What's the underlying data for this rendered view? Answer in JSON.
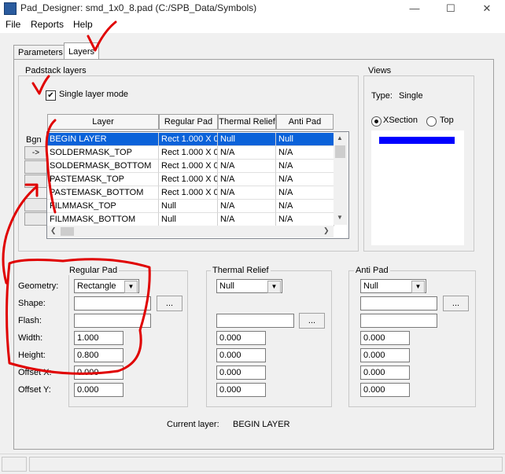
{
  "window": {
    "title": "Pad_Designer: smd_1x0_8.pad (C:/SPB_Data/Symbols)",
    "controls": [
      "—",
      "☐",
      "✕"
    ]
  },
  "menu": [
    "File",
    "Reports",
    "Help"
  ],
  "tabs": [
    {
      "label": "Parameters",
      "active": false
    },
    {
      "label": "Layers",
      "active": true
    }
  ],
  "padstack": {
    "group_label": "Padstack layers",
    "single_layer_mode_label": "Single layer mode",
    "single_layer_mode_checked": true,
    "side_button_label": "Bgn",
    "side_arrow": "->",
    "columns": [
      "Layer",
      "Regular Pad",
      "Thermal Relief",
      "Anti Pad"
    ],
    "rows": [
      {
        "layer": "BEGIN LAYER",
        "regular": "Rect 1.000 X 0",
        "thermal": "Null",
        "anti": "Null",
        "selected": true
      },
      {
        "layer": "SOLDERMASK_TOP",
        "regular": "Rect 1.000 X 0",
        "thermal": "N/A",
        "anti": "N/A",
        "selected": false
      },
      {
        "layer": "SOLDERMASK_BOTTOM",
        "regular": "Rect 1.000 X 0",
        "thermal": "N/A",
        "anti": "N/A",
        "selected": false
      },
      {
        "layer": "PASTEMASK_TOP",
        "regular": "Rect 1.000 X 0",
        "thermal": "N/A",
        "anti": "N/A",
        "selected": false
      },
      {
        "layer": "PASTEMASK_BOTTOM",
        "regular": "Rect 1.000 X 0",
        "thermal": "N/A",
        "anti": "N/A",
        "selected": false
      },
      {
        "layer": "FILMMASK_TOP",
        "regular": "Null",
        "thermal": "N/A",
        "anti": "N/A",
        "selected": false
      },
      {
        "layer": "FILMMASK_BOTTOM",
        "regular": "Null",
        "thermal": "N/A",
        "anti": "N/A",
        "selected": false
      }
    ]
  },
  "views": {
    "group_label": "Views",
    "type_label": "Type:",
    "type_value": "Single",
    "xsection_label": "XSection",
    "top_label": "Top",
    "selected": "XSection",
    "preview_color": "#0000ff"
  },
  "regular_pad": {
    "group_label": "Regular Pad",
    "labels": {
      "geometry": "Geometry:",
      "shape": "Shape:",
      "flash": "Flash:",
      "width": "Width:",
      "height": "Height:",
      "offset_x": "Offset X:",
      "offset_y": "Offset Y:"
    },
    "geometry": "Rectangle",
    "shape": "",
    "flash": "",
    "width": "1.000",
    "height": "0.800",
    "offset_x": "0.000",
    "offset_y": "0.000",
    "browse_label": "..."
  },
  "thermal_relief": {
    "group_label": "Thermal Relief",
    "geometry": "Null",
    "flash": "",
    "width": "0.000",
    "height": "0.000",
    "offset_x": "0.000",
    "offset_y": "0.000",
    "browse_label": "..."
  },
  "anti_pad": {
    "group_label": "Anti Pad",
    "geometry": "Null",
    "shape": "",
    "flash": "",
    "width": "0.000",
    "height": "0.000",
    "offset_x": "0.000",
    "offset_y": "0.000",
    "browse_label": "..."
  },
  "current_layer": {
    "label": "Current layer:",
    "value": "BEGIN LAYER"
  },
  "annotation_color": "#e00000"
}
